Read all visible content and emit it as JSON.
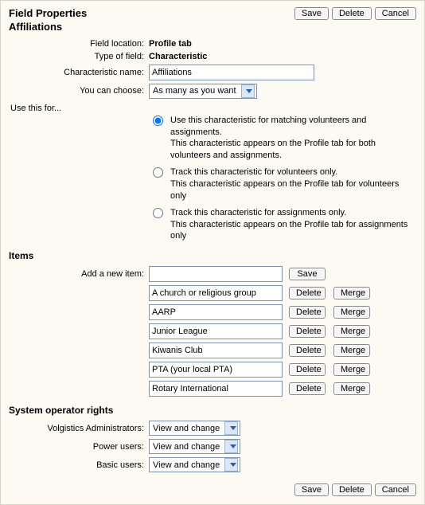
{
  "header": {
    "title": "Field Properties",
    "subtitle": "Affiliations",
    "buttons": {
      "save": "Save",
      "delete": "Delete",
      "cancel": "Cancel"
    }
  },
  "fields": {
    "location_label": "Field location:",
    "location_value": "Profile tab",
    "type_label": "Type of field:",
    "type_value": "Characteristic",
    "name_label": "Characteristic name:",
    "name_value": "Affiliations",
    "choose_label": "You can choose:",
    "choose_value": "As many as you want"
  },
  "use_for": {
    "label": "Use this for...",
    "options": [
      {
        "selected": true,
        "line1": "Use this characteristic for matching volunteers and assignments.",
        "line2": "This characteristic appears on the Profile tab for both volunteers and assignments."
      },
      {
        "selected": false,
        "line1": "Track this characteristic for volunteers only.",
        "line2": "This characteristic appears on the Profile tab for volunteers only"
      },
      {
        "selected": false,
        "line1": "Track this characteristic for assignments only.",
        "line2": "This characteristic appears on the Profile tab for assignments only"
      }
    ]
  },
  "items_section": {
    "heading": "Items",
    "add_label": "Add a new item:",
    "add_value": "",
    "save_label": "Save",
    "delete_label": "Delete",
    "merge_label": "Merge",
    "items": [
      "A church or religious group",
      "AARP",
      "Junior League",
      "Kiwanis Club",
      "PTA (your local PTA)",
      "Rotary International"
    ]
  },
  "rights_section": {
    "heading": "System operator rights",
    "rows": [
      {
        "label": "Volgistics Administrators:",
        "value": "View and change"
      },
      {
        "label": "Power users:",
        "value": "View and change"
      },
      {
        "label": "Basic users:",
        "value": "View and change"
      }
    ]
  },
  "footer": {
    "save": "Save",
    "delete": "Delete",
    "cancel": "Cancel"
  }
}
